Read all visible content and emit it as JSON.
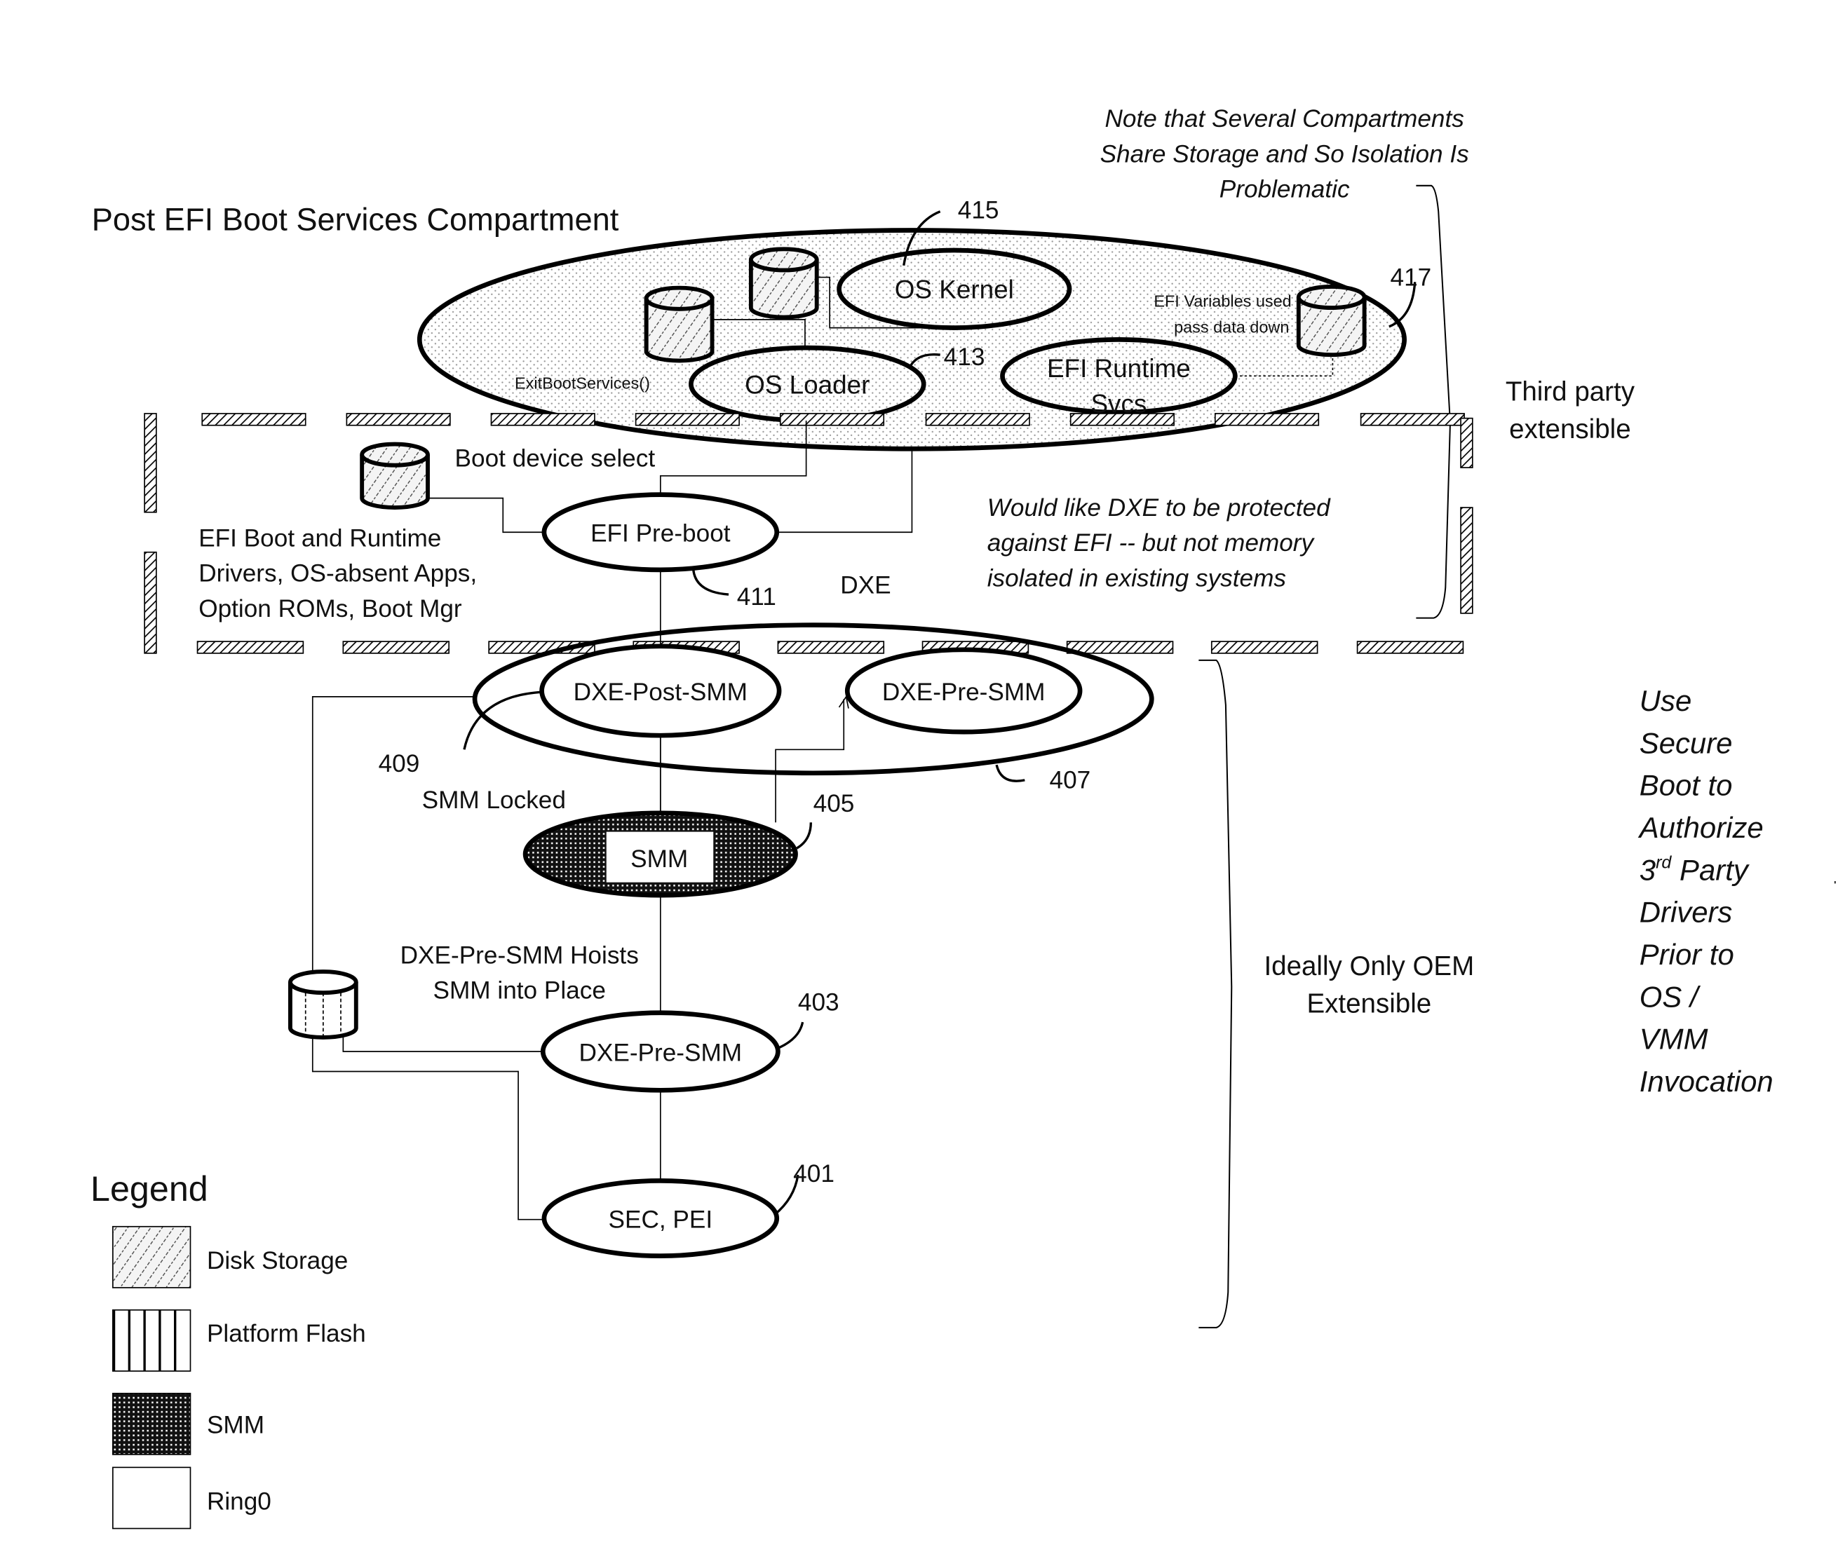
{
  "title": "Post EFI Boot Services Compartment",
  "notes": {
    "shared_storage": [
      "Note that Several Compartments",
      "Share Storage and So Isolation Is",
      "Problematic"
    ],
    "dxe_protection": [
      "Would like DXE to be protected",
      "against EFI -- but not memory",
      "isolated in existing systems"
    ],
    "secure_boot": [
      "Use",
      "Secure",
      "Boot to",
      "Authorize",
      "3",
      "rd",
      " Party",
      "Drivers",
      "Prior to",
      "OS /",
      "VMM",
      "Invocation"
    ]
  },
  "brace_labels": {
    "third_party": [
      "Third party",
      "extensible"
    ],
    "oem": [
      "Ideally Only OEM",
      "Extensible"
    ]
  },
  "nodes": {
    "os_kernel": "OS Kernel",
    "os_loader": "OS Loader",
    "efi_runtime": [
      "EFI Runtime",
      "Svcs"
    ],
    "efi_preboot": "EFI Pre-boot",
    "dxe_post_smm": "DXE-Post-SMM",
    "dxe_pre_smm_upper": "DXE-Pre-SMM",
    "smm": "SMM",
    "dxe_pre_smm_lower": "DXE-Pre-SMM",
    "sec_pei": "SEC, PEI"
  },
  "labels": {
    "exit_boot_services": "ExitBootServices()",
    "efi_variables": [
      "EFI Variables used",
      "pass data down"
    ],
    "boot_device_select": "Boot device select",
    "efi_drivers": [
      "EFI Boot and Runtime",
      "Drivers, OS-absent Apps,",
      "Option ROMs, Boot Mgr"
    ],
    "dxe": "DXE",
    "smm_locked": "SMM Locked",
    "hoists": [
      "DXE-Pre-SMM Hoists",
      "SMM into Place"
    ]
  },
  "refs": {
    "r401": "401",
    "r403": "403",
    "r405": "405",
    "r407": "407",
    "r409": "409",
    "r411": "411",
    "r413": "413",
    "r415": "415",
    "r417": "417"
  },
  "legend": {
    "title": "Legend",
    "items": [
      {
        "label": "Disk Storage",
        "pattern": "diagonal-hatch"
      },
      {
        "label": "Platform Flash",
        "pattern": "vertical-lines"
      },
      {
        "label": "SMM",
        "pattern": "dense-crosshatch"
      },
      {
        "label": "Ring0",
        "pattern": "blank"
      }
    ]
  }
}
